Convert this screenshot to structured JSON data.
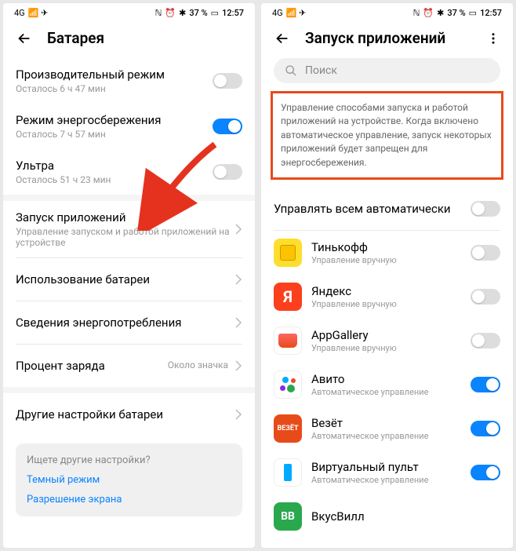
{
  "status": {
    "signal": "4G",
    "icons_left": "📶 ✈",
    "nfc": "ℕ",
    "alarm": "⏰",
    "bt": "✱",
    "battery_pct": "37 %",
    "battery_icon": "▭",
    "time": "12:57"
  },
  "left": {
    "title": "Батарея",
    "rows": {
      "perf": {
        "title": "Производительный режим",
        "sub": "Осталось 6 ч 47 мин"
      },
      "save": {
        "title": "Режим энергосбережения",
        "sub": "Осталось 7 ч 57 мин"
      },
      "ultra": {
        "title": "Ультра",
        "sub": "Осталось 51 ч 23 мин"
      },
      "launch": {
        "title": "Запуск приложений",
        "sub": "Управление запуском и работой приложений на устройстве"
      },
      "usage": {
        "title": "Использование батареи"
      },
      "details": {
        "title": "Сведения энергопотребления"
      },
      "percent": {
        "title": "Процент заряда",
        "value": "Около значка"
      },
      "other": {
        "title": "Другие настройки батареи"
      }
    },
    "help": {
      "title": "Ищете другие настройки?",
      "link1": "Темный режим",
      "link2": "Разрешение экрана"
    }
  },
  "right": {
    "title": "Запуск приложений",
    "search_placeholder": "Поиск",
    "info": "Управление способами запуска и работой приложений на устройстве. Когда включено автоматическое управление, запуск некоторых приложений будет запрещен для энергосбережения.",
    "manage_all": "Управлять всем автоматически",
    "sub_manual": "Управление вручную",
    "sub_auto": "Автоматическое управление",
    "apps": {
      "tinkoff": "Тинькофф",
      "yandex": "Яндекс",
      "appgallery": "AppGallery",
      "avito": "Авито",
      "vezet": "Везёт",
      "vezet_label": "ВЕЗЁТ",
      "remote": "Виртуальный пульт",
      "vkusvill": "ВкусВилл",
      "vkusvill_label": "ВВ",
      "yandex_label": "Я"
    }
  }
}
